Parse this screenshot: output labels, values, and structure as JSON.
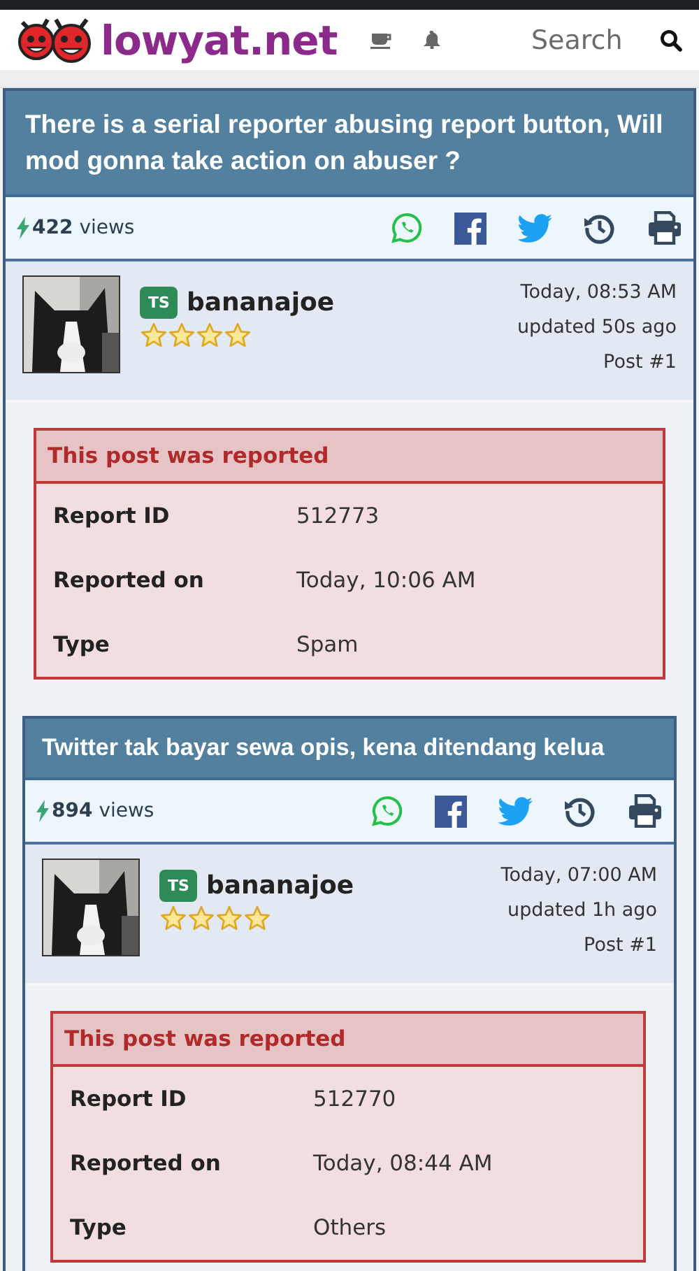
{
  "header": {
    "logo_text": "lowyat.net",
    "search_placeholder": "Search"
  },
  "post": {
    "title": "There is a serial reporter abusing report button, Will mod gonna take action on abuser ?",
    "views_count": "422",
    "views_label": "views",
    "author": {
      "badge": "TS",
      "name": "bananajoe",
      "stars": 4
    },
    "time": "Today, 08:53 AM",
    "updated": "updated 50s ago",
    "post_number": "Post #1",
    "report": {
      "heading": "This post was reported",
      "rows": [
        {
          "label": "Report ID",
          "value": "512773"
        },
        {
          "label": "Reported on",
          "value": "Today, 10:06 AM"
        },
        {
          "label": "Type",
          "value": "Spam"
        }
      ]
    },
    "embedded_post": {
      "title": "Twitter tak bayar sewa opis, kena ditendang kelua",
      "views_count": "894",
      "views_label": "views",
      "author": {
        "badge": "TS",
        "name": "bananajoe",
        "stars": 4
      },
      "time": "Today, 07:00 AM",
      "updated": "updated 1h ago",
      "post_number": "Post #1",
      "report": {
        "heading": "This post was reported",
        "rows": [
          {
            "label": "Report ID",
            "value": "512770"
          },
          {
            "label": "Reported on",
            "value": "Today, 08:44 AM"
          },
          {
            "label": "Type",
            "value": "Others"
          }
        ]
      }
    }
  }
}
